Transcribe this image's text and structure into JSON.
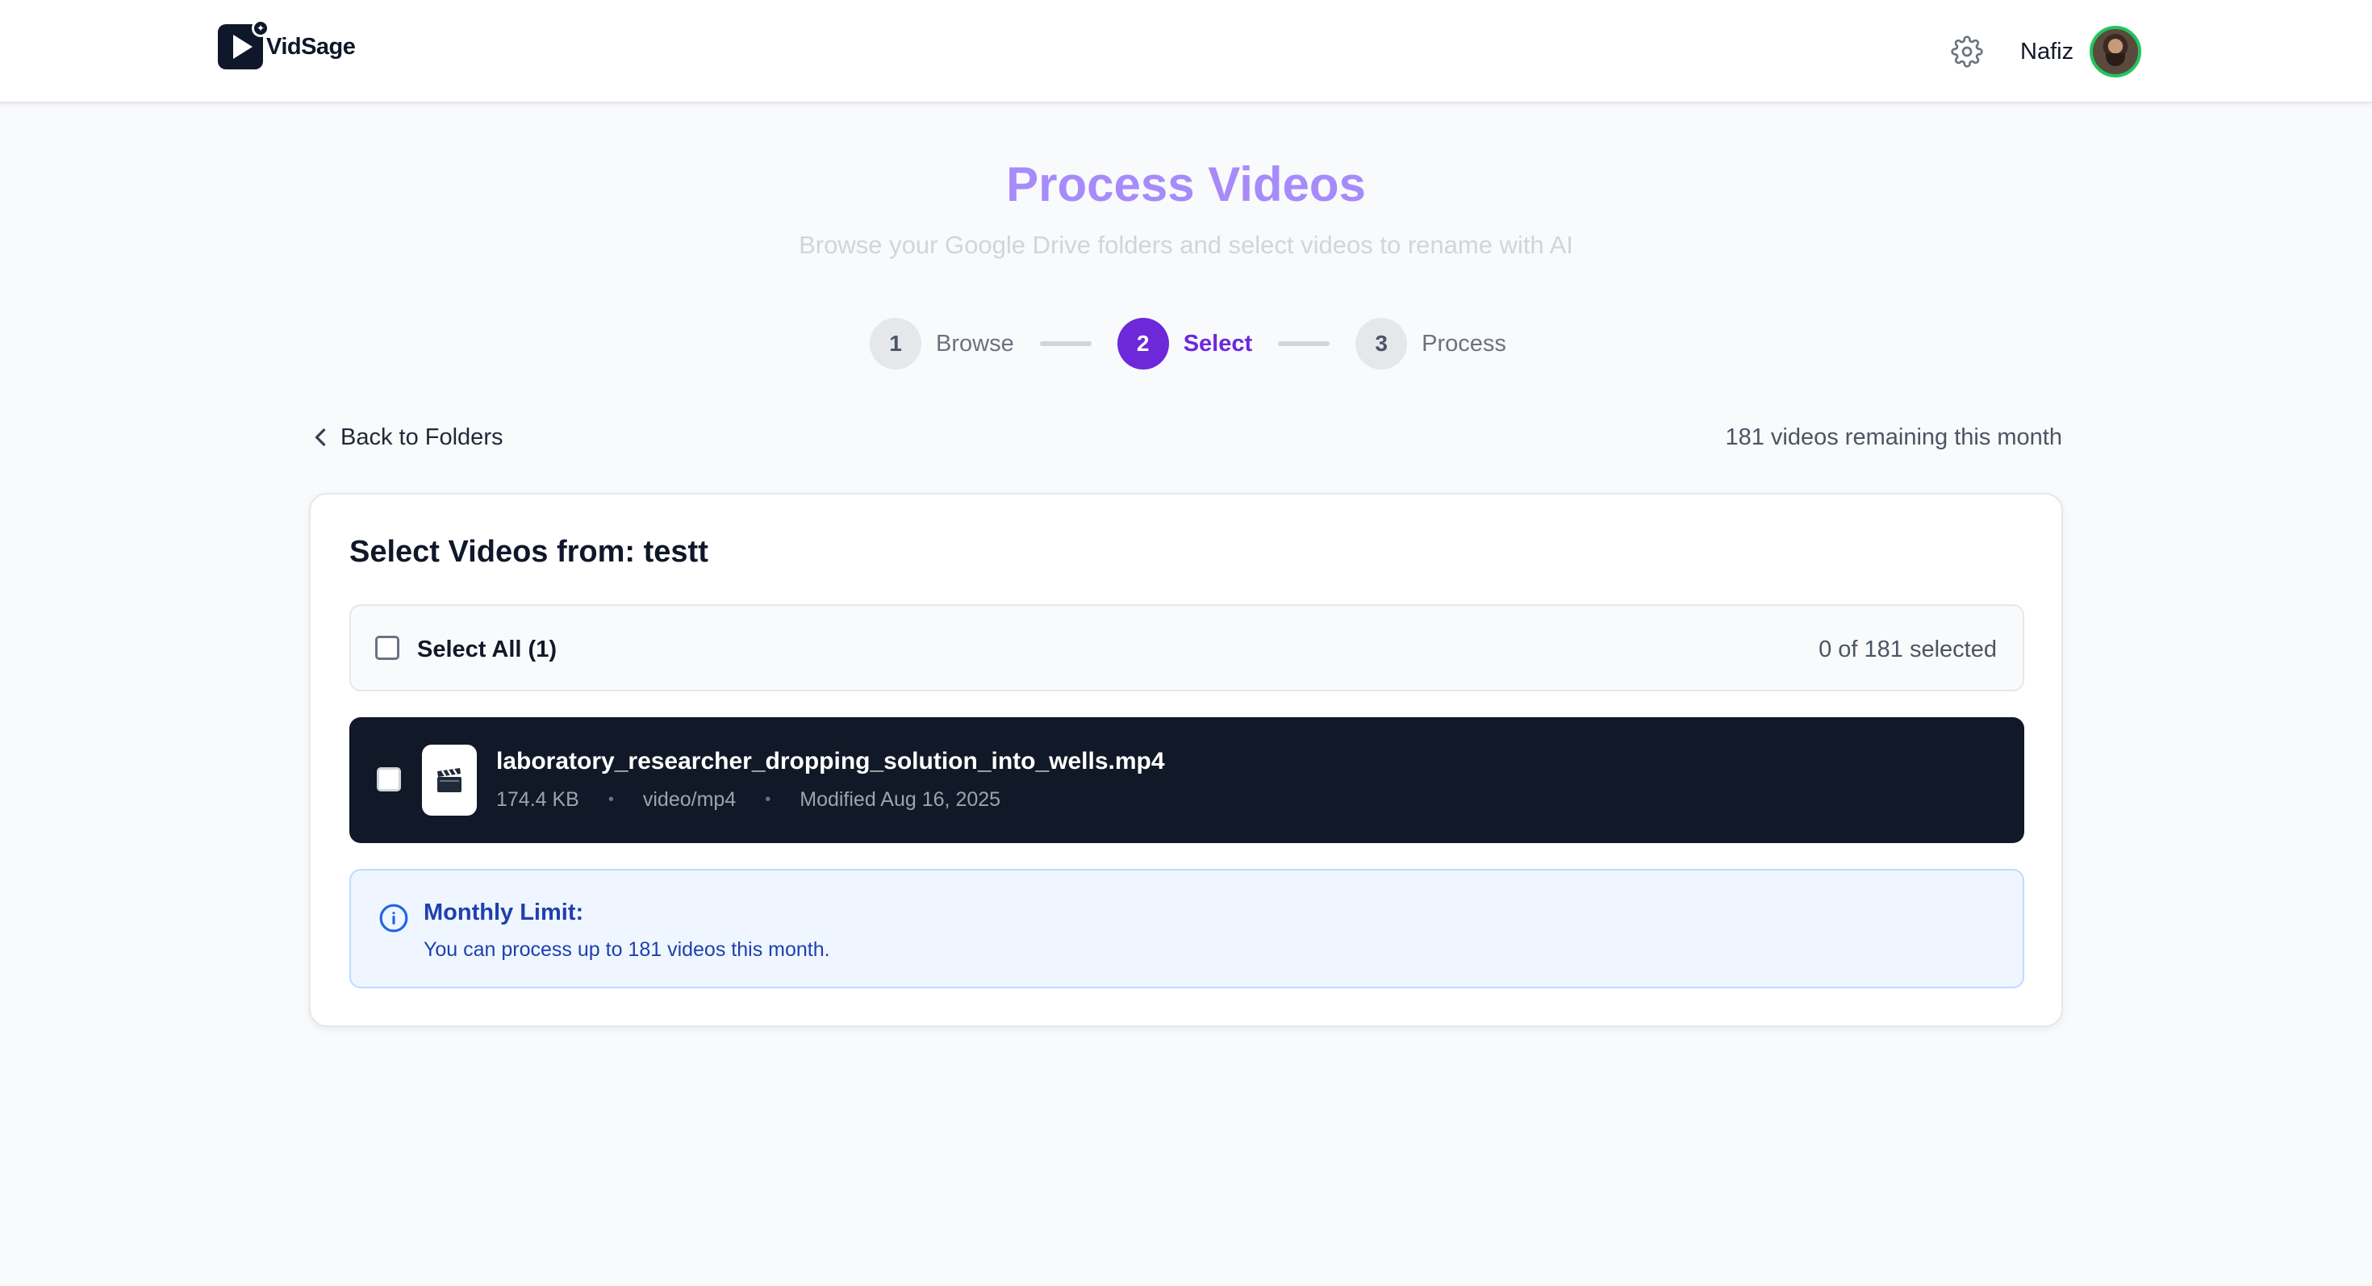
{
  "header": {
    "brand": "VidSage",
    "user_name": "Nafiz",
    "icons": [
      "logo-icon",
      "gear-icon",
      "avatar"
    ]
  },
  "page": {
    "title": "Process Videos",
    "subtitle": "Browse your Google Drive folders and select videos to rename with AI"
  },
  "steps": [
    {
      "number": "1",
      "label": "Browse",
      "state": "done"
    },
    {
      "number": "2",
      "label": "Select",
      "state": "active"
    },
    {
      "number": "3",
      "label": "Process",
      "state": "pending"
    }
  ],
  "nav": {
    "back_label": "Back to Folders",
    "remaining": "181 videos remaining this month"
  },
  "card": {
    "title": "Select Videos from: testt",
    "select_all_label": "Select All (1)",
    "selected_count": "0 of 181 selected",
    "videos": [
      {
        "name": "laboratory_researcher_dropping_solution_into_wells.mp4",
        "size": "174.4 KB",
        "type": "video/mp4",
        "modified": "Modified Aug 16, 2025",
        "icon": "clapperboard-icon",
        "checked": false
      }
    ],
    "notice": {
      "title": "Monthly Limit:",
      "text": "You can process up to 181 videos this month.",
      "icon": "info-icon"
    }
  },
  "colors": {
    "accent": "#6d28d9",
    "title": "#a78bfa",
    "row_bg": "#111827",
    "notice_bg": "#eff6ff",
    "notice_text": "#1e40af",
    "avatar_ring": "#22c55e"
  }
}
